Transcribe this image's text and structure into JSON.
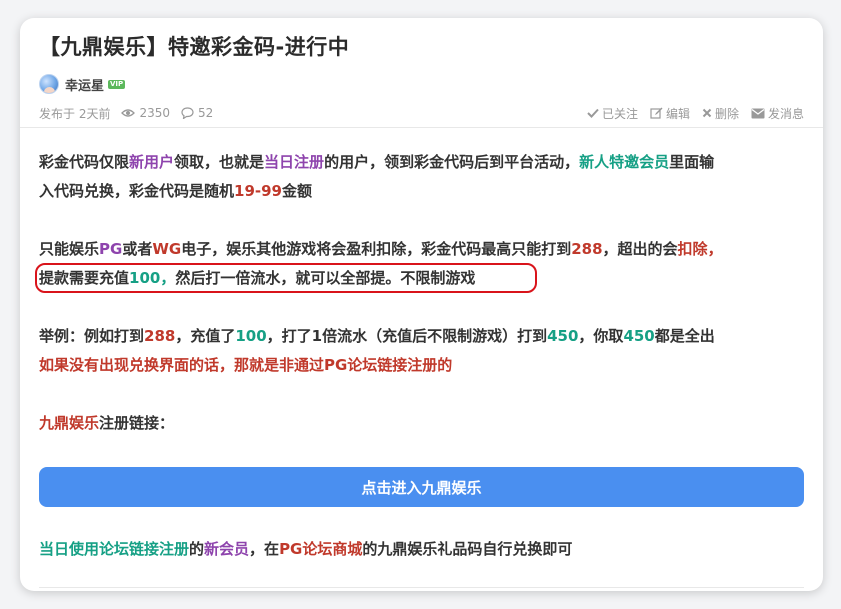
{
  "post": {
    "title": "【九鼎娱乐】特邀彩金码-进行中",
    "author": "幸运星",
    "author_badge": "VIP",
    "posted": "发布于 2天前",
    "views": "2350",
    "comments": "52"
  },
  "actions": {
    "followed": "已关注",
    "edit": "编辑",
    "delete": "删除",
    "message": "发消息"
  },
  "p1": {
    "a": "彩金代码仅限",
    "b": "新用户",
    "c": "领取，也就是",
    "d": "当日注册",
    "e": "的用户，领到彩金代码后到平台活动，",
    "f": "新人特邀会员",
    "g": "里面输",
    "h": "入代码兑换，彩金代码是随机",
    "i": "19-99",
    "j": "金额"
  },
  "p2": {
    "a": "只能娱乐",
    "b": "PG",
    "c": "或者",
    "d": "WG",
    "e": "电子，娱乐其他游戏将会盈利扣除，彩金代码最高只能打到",
    "f": "288",
    "g": "，超出的会",
    "h": "扣除",
    "i": "，",
    "j": "提款需要充值",
    "k": "100",
    "l": "，",
    "m": "然后打一倍流水，就可以全部提。不限制游戏"
  },
  "p3": {
    "a": "举例：例如打到",
    "b": "288",
    "c": "，充值了",
    "d": "100",
    "e": "，打了1倍流水（充值后不限制游戏）打到",
    "f": "450",
    "g": "，你取",
    "h": "450",
    "i": "都是全出",
    "j": "如果没有出现兑换界面的话，那就是非通过PG论坛链接注册的"
  },
  "p4": {
    "a": "九鼎娱乐",
    "b": "注册链接："
  },
  "cta": {
    "label": "点击进入九鼎娱乐"
  },
  "p5": {
    "a": "当日使用论坛链接注册",
    "b": "的",
    "c": "新会员",
    "d": "，在",
    "e": "PG论坛商城",
    "f": "的九鼎娱乐礼品码自行兑换即可"
  },
  "colors": {
    "purple": "#8e44ad",
    "red": "#c0392b",
    "green": "#16a085",
    "button": "#4a8ff0",
    "highlight_border": "#d9141b"
  }
}
